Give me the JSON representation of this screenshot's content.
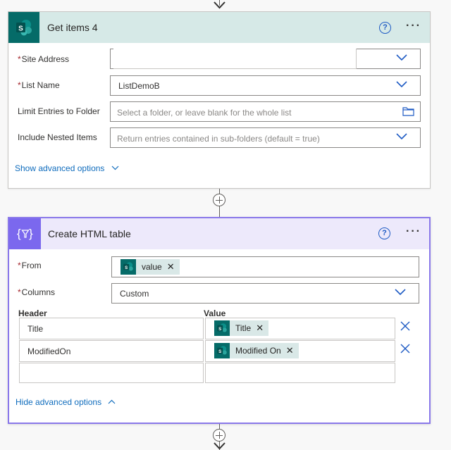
{
  "card1": {
    "title": "Get items 4",
    "fields": [
      {
        "label": "Site Address",
        "required": true,
        "value": "",
        "placeholder": ""
      },
      {
        "label": "List Name",
        "required": true,
        "value": "ListDemoB"
      },
      {
        "label": "Limit Entries to Folder",
        "required": false,
        "placeholder": "Select a folder, or leave blank for the whole list"
      },
      {
        "label": "Include Nested Items",
        "required": false,
        "placeholder": "Return entries contained in sub-folders (default = true)"
      }
    ],
    "advanced_link": "Show advanced options"
  },
  "card2": {
    "title": "Create HTML table",
    "from_label": "From",
    "from_token": "value",
    "columns_label": "Columns",
    "columns_value": "Custom",
    "header_col": "Header",
    "value_col": "Value",
    "rows": [
      {
        "header": "Title",
        "token": "Title"
      },
      {
        "header": "ModifiedOn",
        "token": "Modified On"
      }
    ],
    "advanced_link": "Hide advanced options"
  },
  "colors": {
    "accent": "#8a78ea",
    "sharepoint": "#056b68",
    "link": "#0f6cbd",
    "required": "#a4262c"
  },
  "icons": [
    "sharepoint-icon",
    "data-operation-icon",
    "help-icon",
    "more-icon",
    "chevron-down-icon",
    "folder-icon",
    "plus-icon",
    "arrow-down-icon",
    "delete-icon"
  ]
}
